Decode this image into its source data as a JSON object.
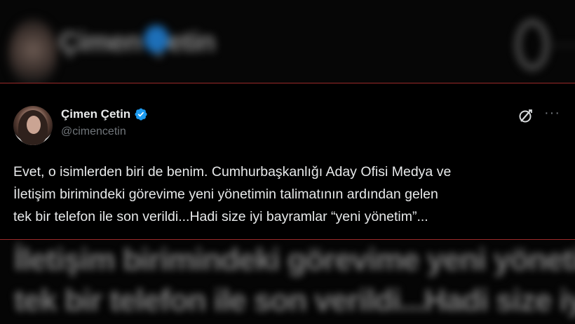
{
  "background": {
    "top_name": "Çimen Çetin",
    "bottom_lines": [
      "İletişim birimindeki görevime yeni yönetimin talimatının ardından gelen",
      "tek bir telefon ile son verildi...Hadi size iyi bayramlar “yeni yönetim”..."
    ]
  },
  "tweet": {
    "display_name": "Çimen Çetin",
    "handle": "@cimencetin",
    "text": "Evet, o  isimlerden biri de benim. Cumhurbaşkanlığı Aday Ofisi Medya ve\nİletişim birimindeki görevime yeni yönetimin talimatının ardından gelen\ntek bir telefon ile son verildi...Hadi size iyi bayramlar “yeni yönetim”...",
    "more_label": "···",
    "icons": {
      "verified": "verified-badge-icon",
      "grok": "grok-icon",
      "more": "more-options-icon"
    },
    "colors": {
      "verified": "#1d9bf0",
      "divider": "#9b2a2a"
    }
  }
}
